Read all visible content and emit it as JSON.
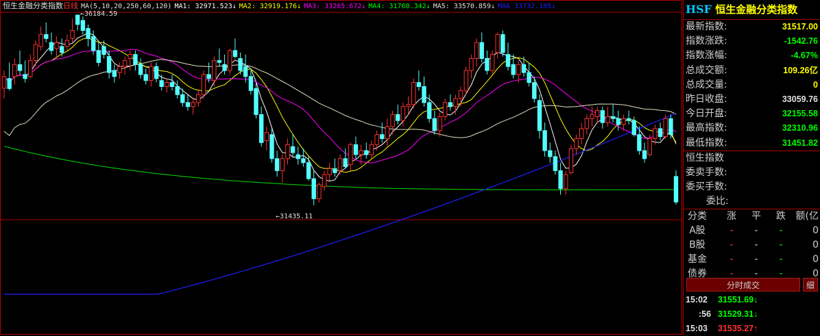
{
  "chart": {
    "title": "恒生金融分类指数",
    "period": "日线",
    "ma_prefix": "MA(5,10,20,250,60,120)",
    "ma_values": [
      {
        "label": "MA1: 32971.523↓",
        "color": "#ffffff"
      },
      {
        "label": "MA2: 32919.176↓",
        "color": "#ffff00"
      },
      {
        "label": "MA3: 33265.672↓",
        "color": "#ff00ff"
      },
      {
        "label": "MA4: 31760.342↓",
        "color": "#00ff00"
      },
      {
        "label": "MA5: 33570.859↓",
        "color": "#e0e0e0"
      },
      {
        "label": "MA6  33732.105↓",
        "color": "#2020ff"
      }
    ],
    "high_label": "36184.59",
    "low_label": "31435.11"
  },
  "panel": {
    "code": "HSF",
    "name": "恒生金融分类指数",
    "quotes": [
      {
        "label": "最新指数:",
        "value": "31517.00",
        "style": "yellow"
      },
      {
        "label": "指数涨跌:",
        "value": "-1542.76",
        "style": "green"
      },
      {
        "label": "指数涨幅:",
        "value": "-4.67%",
        "style": "green"
      },
      {
        "label": "总成交额:",
        "value": "109.26亿",
        "style": "yellow"
      },
      {
        "label": "总成交量:",
        "value": "0",
        "style": "yellow"
      },
      {
        "label": "昨日收盘:",
        "value": "33059.76",
        "style": "white"
      },
      {
        "label": "今日开盘:",
        "value": "32155.58",
        "style": "green"
      },
      {
        "label": "最高指数:",
        "value": "32310.96",
        "style": "green"
      },
      {
        "label": "最低指数:",
        "value": "31451.82",
        "style": "green"
      }
    ],
    "index_label": "恒生指数",
    "orders": [
      {
        "label": "委卖手数:",
        "value": ""
      },
      {
        "label": "委买手数:",
        "value": ""
      },
      {
        "label": "委比:",
        "value": ""
      }
    ],
    "breakdown_headers": [
      "分类",
      "涨",
      "平",
      "跌",
      "额(亿"
    ],
    "breakdown_rows": [
      {
        "name": "A股",
        "up": "-",
        "flat": "-",
        "down": "-",
        "amount": "0"
      },
      {
        "name": "B股",
        "up": "-",
        "flat": "-",
        "down": "-",
        "amount": "0"
      },
      {
        "name": "基金",
        "up": "-",
        "flat": "-",
        "down": "-",
        "amount": "0"
      },
      {
        "name": "债券",
        "up": "-",
        "flat": "-",
        "down": "-",
        "amount": "0"
      }
    ],
    "trade_tab": "分时成交",
    "detail_tab": "细",
    "trades": [
      {
        "time": "15:02",
        "price": "31551.69",
        "dir": "dn",
        "arrow": "↓"
      },
      {
        "time": ":56",
        "price": "31529.31",
        "dir": "dn",
        "arrow": "↓"
      },
      {
        "time": "15:03",
        "price": "31535.27",
        "dir": "up",
        "arrow": "↑"
      }
    ]
  },
  "colors": {
    "up": "#ff3232",
    "down": "#54ffff",
    "border": "#b00000"
  },
  "chart_data": {
    "type": "candlestick",
    "price_range": [
      31435.11,
      36184.59
    ],
    "candles": [
      {
        "o": 34360,
        "h": 34800,
        "l": 34100,
        "c": 34650
      },
      {
        "o": 34600,
        "h": 35000,
        "l": 34300,
        "c": 34350
      },
      {
        "o": 34650,
        "h": 35100,
        "l": 34450,
        "c": 34950
      },
      {
        "o": 34950,
        "h": 35300,
        "l": 34700,
        "c": 34800
      },
      {
        "o": 34700,
        "h": 35050,
        "l": 34500,
        "c": 34600
      },
      {
        "o": 34650,
        "h": 35200,
        "l": 34600,
        "c": 35050
      },
      {
        "o": 35050,
        "h": 35550,
        "l": 34900,
        "c": 35450
      },
      {
        "o": 35400,
        "h": 35900,
        "l": 35300,
        "c": 35700
      },
      {
        "o": 35700,
        "h": 36000,
        "l": 35500,
        "c": 35600
      },
      {
        "o": 35500,
        "h": 35750,
        "l": 35200,
        "c": 35300
      },
      {
        "o": 35350,
        "h": 35650,
        "l": 35100,
        "c": 35500
      },
      {
        "o": 35400,
        "h": 35600,
        "l": 35150,
        "c": 35250
      },
      {
        "o": 35400,
        "h": 35700,
        "l": 35300,
        "c": 35550
      },
      {
        "o": 35600,
        "h": 36100,
        "l": 35500,
        "c": 35800
      },
      {
        "o": 36184,
        "h": 36184,
        "l": 35800,
        "c": 35950
      },
      {
        "o": 36050,
        "h": 36150,
        "l": 35700,
        "c": 35800
      },
      {
        "o": 35850,
        "h": 35950,
        "l": 35400,
        "c": 35600
      },
      {
        "o": 35650,
        "h": 35800,
        "l": 35200,
        "c": 35300
      },
      {
        "o": 35300,
        "h": 35500,
        "l": 34900,
        "c": 35000
      },
      {
        "o": 35400,
        "h": 35550,
        "l": 35100,
        "c": 35200
      },
      {
        "o": 35150,
        "h": 35300,
        "l": 34600,
        "c": 34750
      },
      {
        "o": 34800,
        "h": 34950,
        "l": 34500,
        "c": 34650
      },
      {
        "o": 34750,
        "h": 35000,
        "l": 34600,
        "c": 34900
      },
      {
        "o": 34900,
        "h": 35150,
        "l": 34700,
        "c": 35050
      },
      {
        "o": 35100,
        "h": 35300,
        "l": 34800,
        "c": 35200
      },
      {
        "o": 35200,
        "h": 35300,
        "l": 34800,
        "c": 34950
      },
      {
        "o": 34950,
        "h": 35100,
        "l": 34600,
        "c": 34700
      },
      {
        "o": 34700,
        "h": 34850,
        "l": 34450,
        "c": 34550
      },
      {
        "o": 34550,
        "h": 35000,
        "l": 34400,
        "c": 34900
      },
      {
        "o": 34900,
        "h": 35000,
        "l": 34500,
        "c": 34600
      },
      {
        "o": 34550,
        "h": 34700,
        "l": 34300,
        "c": 34400
      },
      {
        "o": 34400,
        "h": 34600,
        "l": 34250,
        "c": 34500
      },
      {
        "o": 34500,
        "h": 34700,
        "l": 34300,
        "c": 34400
      },
      {
        "o": 34400,
        "h": 34550,
        "l": 34100,
        "c": 34200
      },
      {
        "o": 34200,
        "h": 34350,
        "l": 33900,
        "c": 34000
      },
      {
        "o": 34000,
        "h": 34200,
        "l": 33800,
        "c": 33900
      },
      {
        "o": 33900,
        "h": 34100,
        "l": 33700,
        "c": 34000
      },
      {
        "o": 34000,
        "h": 34300,
        "l": 33900,
        "c": 34200
      },
      {
        "o": 34200,
        "h": 34800,
        "l": 34100,
        "c": 34700
      },
      {
        "o": 34700,
        "h": 35000,
        "l": 34500,
        "c": 34600
      },
      {
        "o": 34550,
        "h": 35150,
        "l": 34400,
        "c": 35050
      },
      {
        "o": 35050,
        "h": 35350,
        "l": 34900,
        "c": 35000
      },
      {
        "o": 34950,
        "h": 35200,
        "l": 34700,
        "c": 34800
      },
      {
        "o": 34800,
        "h": 35350,
        "l": 34700,
        "c": 35300
      },
      {
        "o": 35300,
        "h": 35600,
        "l": 35100,
        "c": 35150
      },
      {
        "o": 35100,
        "h": 35250,
        "l": 34700,
        "c": 34800
      },
      {
        "o": 34900,
        "h": 35200,
        "l": 34500,
        "c": 34650
      },
      {
        "o": 34650,
        "h": 34800,
        "l": 34200,
        "c": 34300
      },
      {
        "o": 34350,
        "h": 34500,
        "l": 33600,
        "c": 33700
      },
      {
        "o": 33700,
        "h": 33900,
        "l": 32900,
        "c": 33000
      },
      {
        "o": 33050,
        "h": 33400,
        "l": 32800,
        "c": 33250
      },
      {
        "o": 33200,
        "h": 33350,
        "l": 32500,
        "c": 32600
      },
      {
        "o": 32600,
        "h": 32800,
        "l": 32150,
        "c": 32300
      },
      {
        "o": 32300,
        "h": 32700,
        "l": 32000,
        "c": 32600
      },
      {
        "o": 32600,
        "h": 33100,
        "l": 32450,
        "c": 32950
      },
      {
        "o": 32900,
        "h": 33200,
        "l": 32650,
        "c": 32750
      },
      {
        "o": 32700,
        "h": 32900,
        "l": 32450,
        "c": 32600
      },
      {
        "o": 32600,
        "h": 32850,
        "l": 32400,
        "c": 32500
      },
      {
        "o": 32500,
        "h": 32650,
        "l": 32050,
        "c": 32100
      },
      {
        "o": 32100,
        "h": 32300,
        "l": 31435,
        "c": 31600
      },
      {
        "o": 31600,
        "h": 32000,
        "l": 31500,
        "c": 31950
      },
      {
        "o": 31900,
        "h": 32300,
        "l": 31800,
        "c": 32200
      },
      {
        "o": 32200,
        "h": 32500,
        "l": 32050,
        "c": 32350
      },
      {
        "o": 32350,
        "h": 32600,
        "l": 32150,
        "c": 32250
      },
      {
        "o": 32300,
        "h": 32700,
        "l": 32200,
        "c": 32600
      },
      {
        "o": 32600,
        "h": 32850,
        "l": 32350,
        "c": 32400
      },
      {
        "o": 32450,
        "h": 33000,
        "l": 32300,
        "c": 32950
      },
      {
        "o": 32950,
        "h": 33150,
        "l": 32600,
        "c": 32700
      },
      {
        "o": 32700,
        "h": 32950,
        "l": 32450,
        "c": 32800
      },
      {
        "o": 32800,
        "h": 33000,
        "l": 32600,
        "c": 32700
      },
      {
        "o": 32700,
        "h": 33050,
        "l": 32600,
        "c": 32950
      },
      {
        "o": 32950,
        "h": 33300,
        "l": 32800,
        "c": 33200
      },
      {
        "o": 33200,
        "h": 33500,
        "l": 33000,
        "c": 33100
      },
      {
        "o": 33100,
        "h": 33600,
        "l": 32900,
        "c": 33400
      },
      {
        "o": 33400,
        "h": 33800,
        "l": 33200,
        "c": 33700
      },
      {
        "o": 33700,
        "h": 33950,
        "l": 33450,
        "c": 33550
      },
      {
        "o": 33550,
        "h": 34000,
        "l": 33400,
        "c": 33900
      },
      {
        "o": 33900,
        "h": 34150,
        "l": 33700,
        "c": 33950
      },
      {
        "o": 33950,
        "h": 34600,
        "l": 33850,
        "c": 34500
      },
      {
        "o": 34500,
        "h": 34800,
        "l": 34300,
        "c": 34400
      },
      {
        "o": 34400,
        "h": 34650,
        "l": 33900,
        "c": 34000
      },
      {
        "o": 34000,
        "h": 34200,
        "l": 33500,
        "c": 33600
      },
      {
        "o": 33600,
        "h": 33800,
        "l": 33200,
        "c": 33300
      },
      {
        "o": 33300,
        "h": 33750,
        "l": 33150,
        "c": 33650
      },
      {
        "o": 33650,
        "h": 34100,
        "l": 33550,
        "c": 34000
      },
      {
        "o": 34000,
        "h": 34200,
        "l": 33800,
        "c": 33900
      },
      {
        "o": 33900,
        "h": 34200,
        "l": 33700,
        "c": 34100
      },
      {
        "o": 34100,
        "h": 34400,
        "l": 33900,
        "c": 34300
      },
      {
        "o": 34300,
        "h": 34900,
        "l": 34200,
        "c": 34800
      },
      {
        "o": 34800,
        "h": 35200,
        "l": 34600,
        "c": 35100
      },
      {
        "o": 35100,
        "h": 35600,
        "l": 34900,
        "c": 35500
      },
      {
        "o": 35500,
        "h": 35750,
        "l": 35000,
        "c": 35100
      },
      {
        "o": 35100,
        "h": 35300,
        "l": 34700,
        "c": 34800
      },
      {
        "o": 34800,
        "h": 35300,
        "l": 34700,
        "c": 35200
      },
      {
        "o": 35250,
        "h": 35750,
        "l": 35100,
        "c": 35700
      },
      {
        "o": 35700,
        "h": 35800,
        "l": 35150,
        "c": 35250
      },
      {
        "o": 35200,
        "h": 35500,
        "l": 34800,
        "c": 34900
      },
      {
        "o": 34950,
        "h": 35200,
        "l": 34600,
        "c": 34700
      },
      {
        "o": 34700,
        "h": 35050,
        "l": 34500,
        "c": 34950
      },
      {
        "o": 34950,
        "h": 35150,
        "l": 34650,
        "c": 34750
      },
      {
        "o": 34750,
        "h": 35000,
        "l": 34400,
        "c": 34500
      },
      {
        "o": 34500,
        "h": 34650,
        "l": 34000,
        "c": 34100
      },
      {
        "o": 34050,
        "h": 34200,
        "l": 33100,
        "c": 33300
      },
      {
        "o": 33300,
        "h": 33500,
        "l": 32650,
        "c": 32800
      },
      {
        "o": 32800,
        "h": 33000,
        "l": 32500,
        "c": 32650
      },
      {
        "o": 32650,
        "h": 32800,
        "l": 32200,
        "c": 32300
      },
      {
        "o": 32300,
        "h": 32500,
        "l": 31700,
        "c": 31850
      },
      {
        "o": 31850,
        "h": 32300,
        "l": 31700,
        "c": 32200
      },
      {
        "o": 32250,
        "h": 32950,
        "l": 32200,
        "c": 32850
      },
      {
        "o": 32850,
        "h": 33200,
        "l": 32700,
        "c": 33100
      },
      {
        "o": 33100,
        "h": 33500,
        "l": 32950,
        "c": 33350
      },
      {
        "o": 33350,
        "h": 33700,
        "l": 33200,
        "c": 33600
      },
      {
        "o": 33600,
        "h": 33900,
        "l": 33400,
        "c": 33700
      },
      {
        "o": 33650,
        "h": 33900,
        "l": 33500,
        "c": 33800
      },
      {
        "o": 33800,
        "h": 33900,
        "l": 33350,
        "c": 33500
      },
      {
        "o": 33500,
        "h": 33900,
        "l": 33400,
        "c": 33650
      },
      {
        "o": 33650,
        "h": 33950,
        "l": 33500,
        "c": 33600
      },
      {
        "o": 33600,
        "h": 33800,
        "l": 33300,
        "c": 33450
      },
      {
        "o": 33450,
        "h": 33700,
        "l": 33300,
        "c": 33600
      },
      {
        "o": 33600,
        "h": 33800,
        "l": 33450,
        "c": 33550
      },
      {
        "o": 33550,
        "h": 33650,
        "l": 33150,
        "c": 33200
      },
      {
        "o": 33200,
        "h": 33400,
        "l": 32700,
        "c": 32800
      },
      {
        "o": 32800,
        "h": 33000,
        "l": 32500,
        "c": 32600
      },
      {
        "o": 32700,
        "h": 33200,
        "l": 32650,
        "c": 33100
      },
      {
        "o": 33100,
        "h": 33450,
        "l": 32950,
        "c": 33350
      },
      {
        "o": 33350,
        "h": 33500,
        "l": 33050,
        "c": 33150
      },
      {
        "o": 33150,
        "h": 33700,
        "l": 33100,
        "c": 33600
      },
      {
        "o": 33600,
        "h": 33700,
        "l": 33100,
        "c": 33200
      },
      {
        "o": 32155,
        "h": 32311,
        "l": 31451,
        "c": 31517
      }
    ]
  }
}
